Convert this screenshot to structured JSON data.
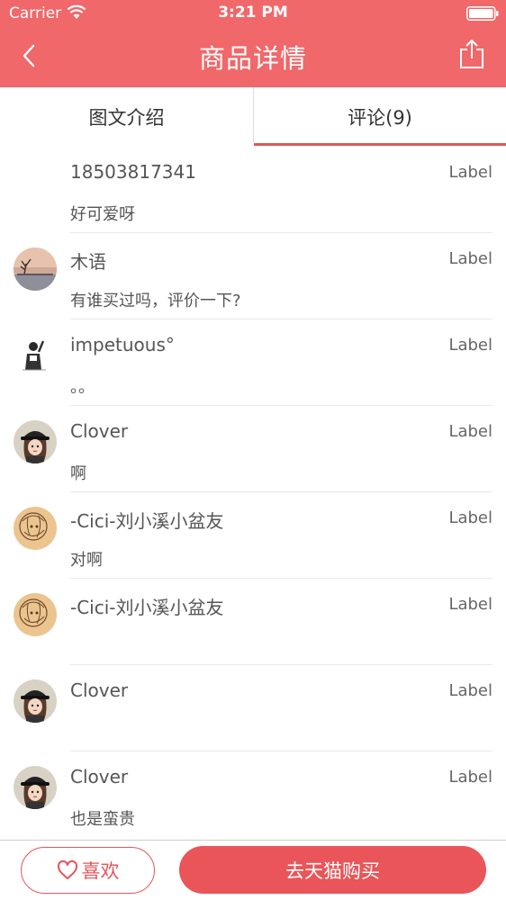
{
  "status_bar": {
    "carrier": "Carrier",
    "time": "3:21 PM"
  },
  "nav": {
    "title": "商品详情",
    "back_icon": "chevron-left-icon",
    "share_icon": "share-icon"
  },
  "tabs": [
    {
      "label": "图文介绍",
      "active": false
    },
    {
      "label": "评论(9)",
      "active": true
    }
  ],
  "comments": [
    {
      "name": "18503817341",
      "label": "Label",
      "text": "好可爱呀",
      "avatar": "none"
    },
    {
      "name": "木语",
      "label": "Label",
      "text": "有谁买过吗，评价一下?",
      "avatar": "lake-tree"
    },
    {
      "name": "impetuous°",
      "label": "Label",
      "text": "。。",
      "avatar": "sketch-figure"
    },
    {
      "name": "Clover",
      "label": "Label",
      "text": "啊",
      "avatar": "girl-hat"
    },
    {
      "name": "-Cici-刘小溪小盆友",
      "label": "Label",
      "text": "对啊",
      "avatar": "sketch-lion"
    },
    {
      "name": "-Cici-刘小溪小盆友",
      "label": "Label",
      "text": "",
      "avatar": "sketch-lion"
    },
    {
      "name": "Clover",
      "label": "Label",
      "text": "",
      "avatar": "girl-hat"
    },
    {
      "name": "Clover",
      "label": "Label",
      "text": "也是蛮贵",
      "avatar": "girl-hat"
    }
  ],
  "bottom_bar": {
    "like_label": "喜欢",
    "like_icon": "heart-icon",
    "buy_label": "去天猫购买"
  },
  "colors": {
    "brand": "#f0686a",
    "accent": "#e95558",
    "tab_indicator": "#e0565a"
  }
}
